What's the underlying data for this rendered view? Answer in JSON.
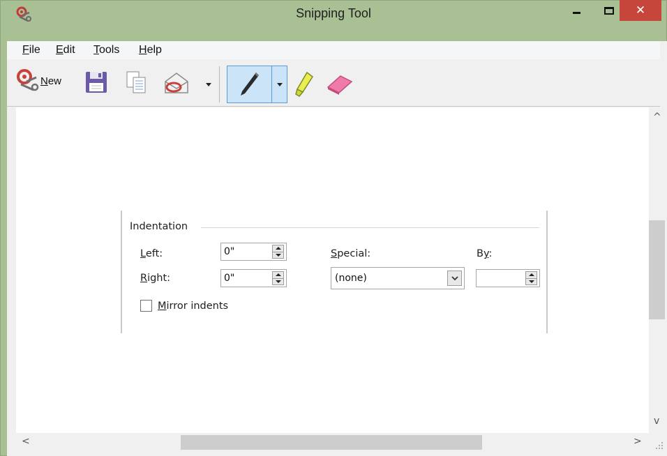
{
  "window": {
    "title": "Snipping Tool",
    "controls": {
      "minimize": "–",
      "maximize": "□",
      "close": "✕"
    },
    "accent": "#a9bf94",
    "close_color": "#c7463b"
  },
  "menu": {
    "file": {
      "ul": "F",
      "rest": "ile"
    },
    "edit": {
      "ul": "E",
      "rest": "dit"
    },
    "tools": {
      "ul": "T",
      "rest": "ools"
    },
    "help": {
      "ul": "H",
      "rest": "elp"
    }
  },
  "toolbar": {
    "new": {
      "icon": "scissors-icon",
      "ul": "N",
      "rest": "ew"
    },
    "save": {
      "icon": "floppy-disk-icon"
    },
    "copy": {
      "icon": "copy-icon"
    },
    "send": {
      "icon": "envelope-icon"
    },
    "pen": {
      "icon": "pen-icon",
      "pressed": true
    },
    "highlighter": {
      "icon": "highlighter-icon"
    },
    "eraser": {
      "icon": "eraser-icon"
    }
  },
  "snip": {
    "group_label": "Indentation",
    "left": {
      "ul": "L",
      "rest": "eft:",
      "value": "0\""
    },
    "right": {
      "ul": "R",
      "rest": "ight:",
      "value": "0\""
    },
    "special": {
      "ul": "S",
      "rest": "pecial:",
      "value": "(none)"
    },
    "by": {
      "pre": "B",
      "ul": "y",
      "rest": ":",
      "value": ""
    },
    "mirror": {
      "ul": "M",
      "rest": "irror indents",
      "checked": false
    }
  },
  "scroll": {
    "up": "^",
    "down": "v",
    "left": "<",
    "right": ">"
  }
}
